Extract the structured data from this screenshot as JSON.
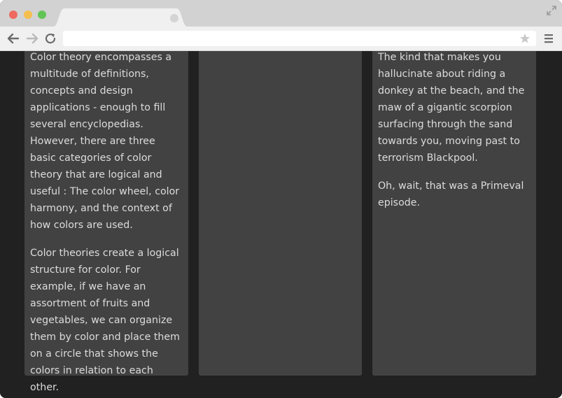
{
  "browser": {
    "tab_title": "",
    "address_placeholder": "",
    "colors": {
      "chrome_bg": "#d2d2d2",
      "toolbar_bg": "#f0f0f0",
      "page_bg": "#212121",
      "card_bg": "#424242",
      "text": "#dcdcdc"
    }
  },
  "columns": [
    {
      "paragraphs": [
        "Color theory encompasses a multitude of definitions, concepts and design applications - enough to fill several encyclopedias. However, there are three basic categories of color theory that are logical and useful : The color wheel, color harmony, and the context of how colors are used.",
        "Color theories create a logical structure for color. For example, if we have an assortment of fruits and vegetables, we can organize them by color and place them on a circle that shows the colors in relation to each other."
      ]
    },
    {
      "paragraphs": []
    },
    {
      "paragraphs": [
        "The kind that makes you hallucinate about riding a donkey at the beach, and the maw of a gigantic scorpion surfacing through the sand towards you, moving past to terrorism Blackpool.",
        "Oh, wait, that was a Primeval episode."
      ]
    }
  ]
}
